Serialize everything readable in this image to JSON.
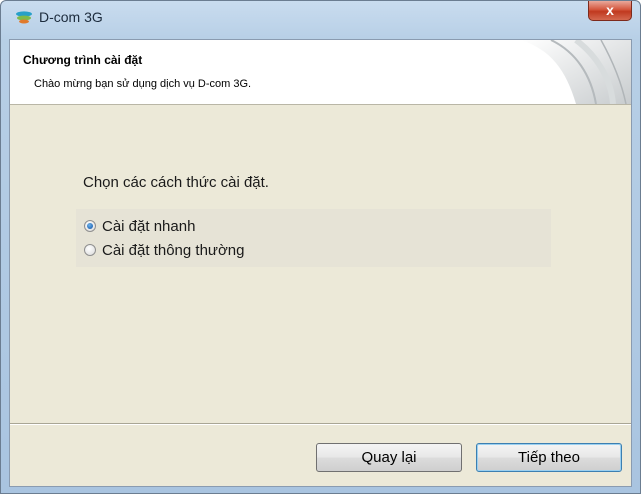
{
  "window": {
    "title": "D-com 3G",
    "close_label": "x"
  },
  "header": {
    "title": "Chương trình cài đặt",
    "subtitle": "Chào mừng bạn sử dụng dịch vụ D-com 3G."
  },
  "main": {
    "instruction": "Chọn các cách thức cài đặt.",
    "options": [
      {
        "label": "Cài đặt nhanh",
        "selected": true
      },
      {
        "label": "Cài đặt thông thường",
        "selected": false
      }
    ]
  },
  "buttons": {
    "back_label": "Quay lại",
    "next_label": "Tiếp theo"
  },
  "icons": {
    "app": "dcom-logo-icon",
    "close": "close-icon"
  },
  "colors": {
    "titlebar": "#b7cfe6",
    "client_bg": "#ece9d8",
    "close_button": "#c0391f"
  }
}
